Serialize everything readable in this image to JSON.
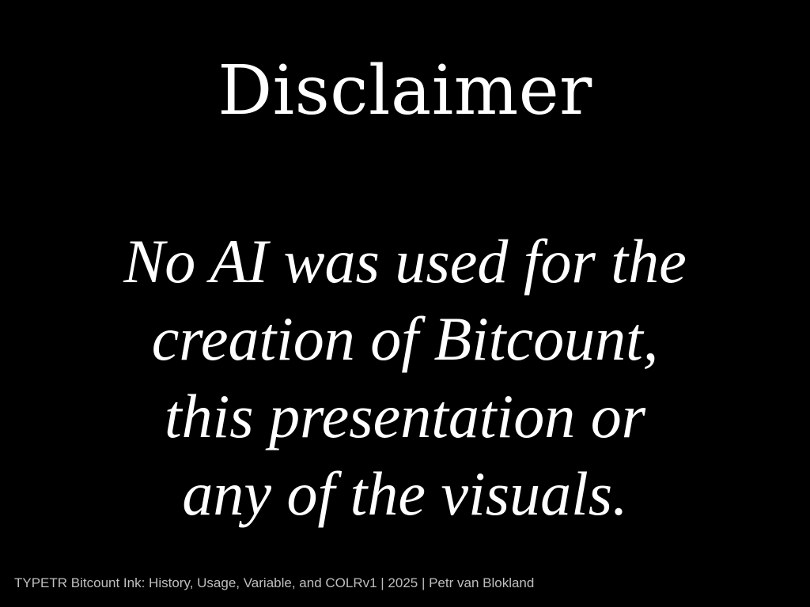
{
  "slide": {
    "title": "Disclaimer",
    "body_lines": [
      "No AI was used for the",
      "creation of Bitcount,",
      "this presentation or",
      "any of the visuals."
    ],
    "footer": "TYPETR Bitcount Ink: History, Usage, Variable, and COLRv1 | 2025 | Petr van Blokland"
  },
  "colors": {
    "background": "#000000",
    "text": "#ffffff",
    "footer_text": "#bfbfbf"
  }
}
